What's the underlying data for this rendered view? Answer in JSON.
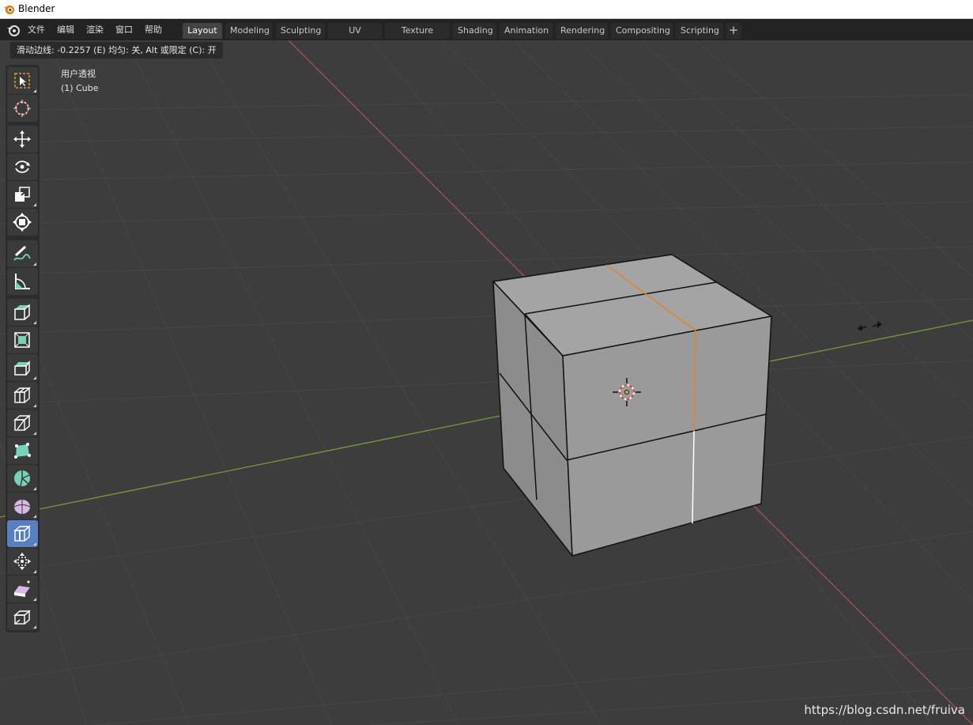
{
  "window": {
    "title": "Blender"
  },
  "menu": [
    "文件",
    "编辑",
    "渲染",
    "窗口",
    "帮助"
  ],
  "workspaces": {
    "tabs": [
      "Layout",
      "Modeling",
      "Sculpting",
      "UV Editing",
      "Texture Paint",
      "Shading",
      "Animation",
      "Rendering",
      "Compositing",
      "Scripting"
    ],
    "active": "Layout",
    "add_label": "+"
  },
  "operator_status": "滑动边线: -0.2257 (E) 均匀: 关, Alt 或限定 (C): 开",
  "viewport": {
    "view_name": "用户透视",
    "object_label": "(1) Cube"
  },
  "toolbar": {
    "active_tool": "edge-slide-tool",
    "tools": [
      {
        "name": "select-box-icon"
      },
      {
        "name": "cursor-icon"
      },
      {
        "name": "move-icon"
      },
      {
        "name": "rotate-icon"
      },
      {
        "name": "scale-icon"
      },
      {
        "name": "transform-icon"
      },
      {
        "name": "annotate-icon"
      },
      {
        "name": "measure-icon"
      },
      {
        "name": "extrude-region-icon"
      },
      {
        "name": "inset-faces-icon"
      },
      {
        "name": "bevel-icon"
      },
      {
        "name": "loop-cut-icon"
      },
      {
        "name": "knife-icon"
      },
      {
        "name": "poly-build-icon"
      },
      {
        "name": "spin-icon"
      },
      {
        "name": "smooth-icon"
      },
      {
        "name": "edge-slide-icon"
      },
      {
        "name": "shrink-fatten-icon"
      },
      {
        "name": "shear-icon"
      },
      {
        "name": "rip-region-icon"
      }
    ]
  },
  "colors": {
    "x_axis": "#b34c57",
    "y_axis": "#7a9a3a",
    "selected_edge": "#e0832a",
    "active_tool": "#5680c2",
    "mesh_face": "#9a9a9a"
  },
  "watermark": "https://blog.csdn.net/fruiva"
}
